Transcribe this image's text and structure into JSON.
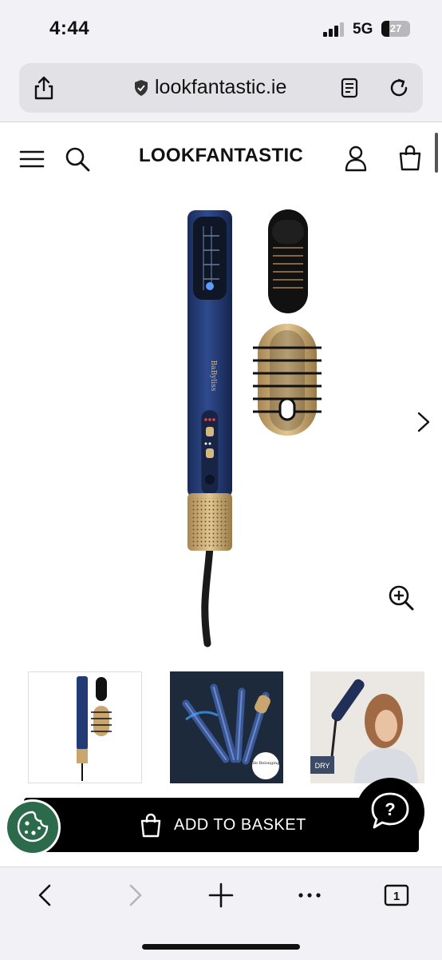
{
  "status_bar": {
    "time": "4:44",
    "network": "5G",
    "battery": "27",
    "battery_fraction": 0.27
  },
  "browser": {
    "url": "lookfantastic.ie",
    "icons": [
      "share-icon",
      "lock-shield-icon",
      "reader-icon",
      "reload-icon"
    ]
  },
  "site_header": {
    "brand": "LOOKFANTASTIC",
    "icons": [
      "menu-icon",
      "search-icon",
      "account-icon",
      "bag-icon"
    ]
  },
  "product": {
    "device_brand": "BaByliss",
    "thumbnails": [
      {
        "caption": ""
      },
      {
        "badge": "Elle Belongings"
      },
      {
        "label": "DRY"
      }
    ],
    "add_to_basket": "ADD TO BASKET"
  },
  "colors": {
    "device_blue": "#233b75",
    "gold": "#c9a670",
    "cookie_green": "#2c6a4c"
  }
}
